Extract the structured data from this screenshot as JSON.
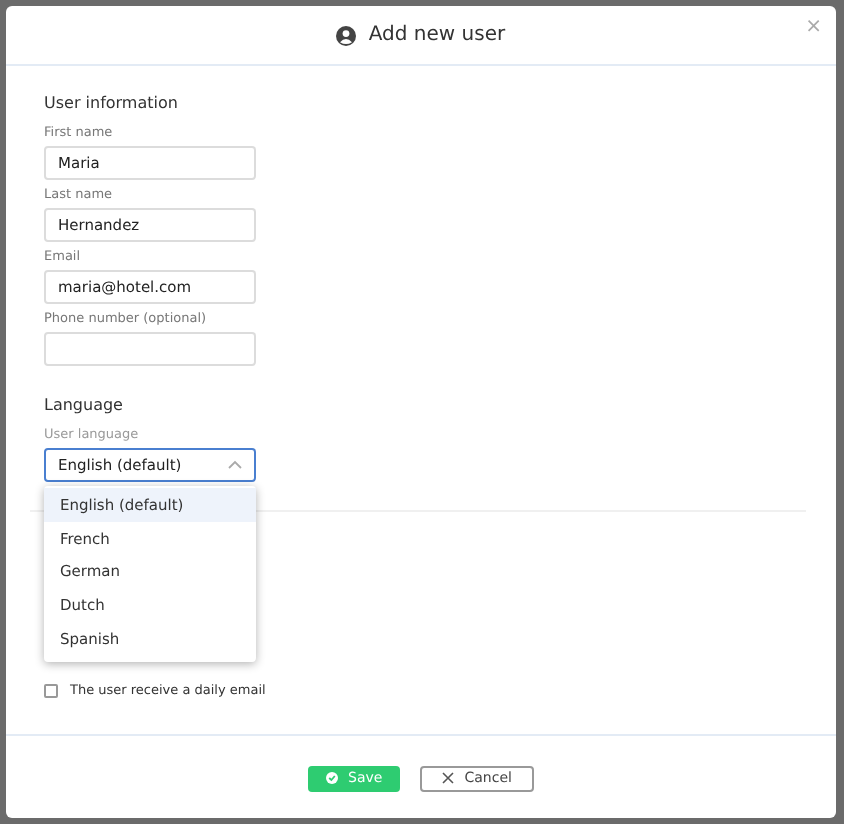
{
  "dialog": {
    "title": "Add new user",
    "close": "×"
  },
  "user_information": {
    "title": "User information",
    "fields": [
      {
        "label": "First name",
        "value": "Maria"
      },
      {
        "label": "Last name",
        "value": "Hernandez"
      },
      {
        "label": "Email",
        "value": "maria@hotel.com"
      },
      {
        "label": "Phone number (optional)"
      }
    ]
  },
  "language": {
    "title": "Language",
    "field_label": "User language",
    "value": "English (default)",
    "expanded": true,
    "options": [
      {
        "label": "English (default)",
        "selected": true
      },
      {
        "label": "French",
        "selected": false
      },
      {
        "label": "German",
        "selected": false
      },
      {
        "label": "Dutch",
        "selected": false
      },
      {
        "label": "Spanish",
        "selected": false
      }
    ]
  },
  "daily_email": {
    "label": "The user receive a daily email",
    "checked": false
  },
  "buttons": [
    {
      "label": "Save",
      "kind": "primary"
    },
    {
      "label": "Cancel",
      "kind": "secondary"
    }
  ]
}
